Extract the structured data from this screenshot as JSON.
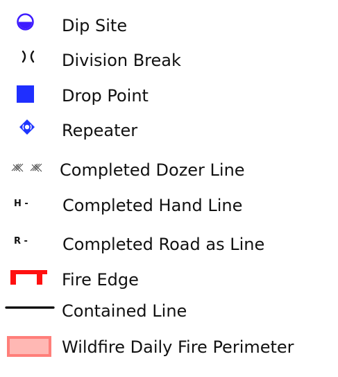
{
  "legend": {
    "items": [
      {
        "label": "Dip Site",
        "icon": "dip-site-icon"
      },
      {
        "label": "Division Break",
        "icon": "division-break-icon"
      },
      {
        "label": "Drop Point",
        "icon": "drop-point-icon"
      },
      {
        "label": "Repeater",
        "icon": "repeater-icon"
      },
      {
        "label": "Completed Dozer Line",
        "icon": "completed-dozer-line-icon"
      },
      {
        "label": "Completed Hand Line",
        "icon": "completed-hand-line-icon",
        "symbol_text": "H -"
      },
      {
        "label": "Completed Road as Line",
        "icon": "completed-road-as-line-icon",
        "symbol_text": "R -"
      },
      {
        "label": "Fire Edge",
        "icon": "fire-edge-icon"
      },
      {
        "label": "Contained Line",
        "icon": "contained-line-icon"
      },
      {
        "label": "Wildfire Daily Fire Perimeter",
        "icon": "wildfire-daily-fire-perimeter-icon"
      }
    ]
  },
  "colors": {
    "dip_site": "#3d1bff",
    "drop_point": "#1f2fff",
    "repeater": "#1e35ff",
    "dozer_hatch": "#444444",
    "hand_line": "#111111",
    "road_line": "#111111",
    "fire_edge": "#ff1010",
    "contained_line": "#000000",
    "perimeter_fill": "#ffb8b4",
    "perimeter_stroke": "#ff7f7a"
  }
}
